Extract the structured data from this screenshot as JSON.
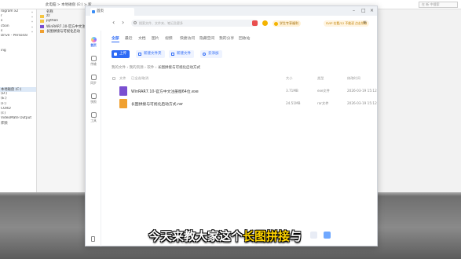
{
  "explorer": {
    "crumb": "此电脑 > 本地磁盘 (E:) > 新",
    "search_placeholder": "在 新 中搜索",
    "pins": [
      "*",
      "*",
      "*",
      "*",
      "*"
    ],
    "sidebar": [
      "rogram x2",
      "r",
      "s",
      "ction",
      "s",
      "Drive - Personal",
      "",
      "",
      "ing",
      "",
      "",
      "",
      "",
      "",
      "",
      "",
      "本地磁盘 (C:)",
      "(D:)",
      "(E:)",
      "(F:)",
      "CORD",
      "(I:)",
      "VideoMate Output",
      "库频",
      "",
      "",
      "",
      "",
      "",
      "",
      "",
      "",
      "",
      "",
      "",
      "",
      ""
    ],
    "list": [
      "名称",
      "zz",
      "python",
      "WinRAR7.10-官方中文注",
      "长图拼接与可视化启动"
    ]
  },
  "window": {
    "tab_title": "首页",
    "search_placeholder": "搜索文件、文件夹、笔记及更多",
    "student_badge": "学生专享福利",
    "vip_badge_text": "SVIP 在看/12 不能读 点击领取",
    "nav": [
      {
        "label": "首页",
        "icon": "home-icon"
      },
      {
        "label": "传输",
        "icon": "transfer-icon"
      },
      {
        "label": "同步",
        "icon": "sync-icon"
      },
      {
        "label": "快照",
        "icon": "snapshot-icon"
      },
      {
        "label": "工具",
        "icon": "tools-icon"
      }
    ],
    "content_tabs": [
      "全部",
      "最近",
      "文档",
      "图片",
      "视频",
      "快捷访问",
      "隐藏空间",
      "我的分享",
      "回收站"
    ],
    "actions": {
      "upload": "上传",
      "new_folder": "新建文件夹",
      "new_doc": "新建文件",
      "cloud_add": "云添加"
    },
    "breadcrumb": [
      "我的文件",
      "我的资源",
      "软件",
      "长图拼接与可视化启动方式"
    ],
    "table_headers": [
      "文件",
      "已全选/取消",
      "大小",
      "类型",
      "修改时间"
    ],
    "files": [
      {
        "name": "WinRAR7.10-官方中文注册版64位.exe",
        "size": "3.71MB",
        "type": "exe文件",
        "modified": "2026-03-19 15:12",
        "icon_color": "#7a4fd0"
      },
      {
        "name": "长图拼接与可视化启动方式.rar",
        "size": "24.51MB",
        "type": "rar文件",
        "modified": "2026-03-19 15:12",
        "icon_color": "#f0a030"
      }
    ]
  },
  "subtitle": {
    "prefix": "今天来教大家这个",
    "highlight": "长图拼接",
    "suffix": "与"
  }
}
